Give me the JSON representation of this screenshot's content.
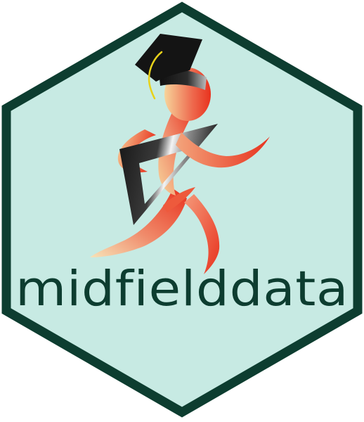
{
  "logo": {
    "wordmark": "midfielddata",
    "colors": {
      "hex_fill": "#c7eae3",
      "hex_border": "#0d3d30",
      "wordmark": "#0d3d30",
      "figure_red": "#e8321e",
      "figure_light": "#f7d49b",
      "cap": "#141414",
      "tassel": "#e8d21a",
      "book_light": "#f2f2f2",
      "book_dark": "#1a1a1a"
    },
    "icons": {
      "figure": "running-graduate-icon",
      "cap": "graduation-cap-icon",
      "book": "book-icon"
    }
  }
}
